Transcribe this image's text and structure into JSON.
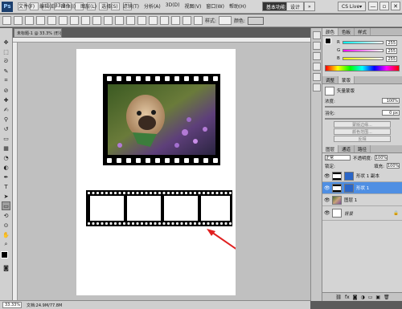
{
  "app": {
    "logo": "Ps",
    "zoom_select": "33.3"
  },
  "menu": [
    "文件(F)",
    "编辑(E)",
    "图像(I)",
    "图层(L)",
    "选择(S)",
    "滤镜(T)",
    "分析(A)",
    "3D(D)",
    "视图(V)",
    "窗口(W)",
    "帮助(H)"
  ],
  "workspace": {
    "basic": "基本功能",
    "design": "设计",
    "more": "»",
    "cslive": "CS Live▾"
  },
  "window_controls": [
    "—",
    "▫",
    "✕"
  ],
  "options_bar": {
    "style_label": "样式:",
    "color_label": "颜色:",
    "stroke_color": "#000000",
    "fill_color": "#000000"
  },
  "document": {
    "tab_title": "未标题-1 @ 33.3% (形状 1, RGB/8)"
  },
  "status_bar": {
    "zoom": "33.33%",
    "doc_info": "文档:24.9M/77.8M"
  },
  "panels": {
    "color_tabs": [
      "颜色",
      "色板",
      "样式"
    ],
    "channels": [
      {
        "label": "R",
        "value": "255",
        "gradient": "linear-gradient(to right,#00ff00,#ffff00)"
      },
      {
        "label": "G",
        "value": "255",
        "gradient": "linear-gradient(to right,#ff00ff,#ffffff)"
      },
      {
        "label": "B",
        "value": "255",
        "gradient": "linear-gradient(to right,#ffff00,#ffffff)"
      }
    ],
    "adjust_tabs": [
      "调整",
      "蒙版"
    ],
    "mask_title": "矢量蒙版",
    "density_label": "浓度:",
    "density_value": "100%",
    "feather_label": "羽化:",
    "feather_value": "0 px",
    "buttons": [
      "蒙版边缘...",
      "颜色范围...",
      "反相"
    ],
    "layer_tabs": [
      "图层",
      "通道",
      "路径"
    ],
    "blend_mode": "正常",
    "opacity_label": "不透明度:",
    "opacity_value": "100%",
    "lock_label": "锁定:",
    "fill_label": "填充:",
    "fill_value": "100%",
    "layers": [
      {
        "name": "形状 1 副本",
        "thumb": "film"
      },
      {
        "name": "形状 1",
        "thumb": "film",
        "selected": true
      },
      {
        "name": "图层 1",
        "thumb": "photo"
      },
      {
        "name": "背景",
        "thumb": "plain"
      }
    ]
  }
}
